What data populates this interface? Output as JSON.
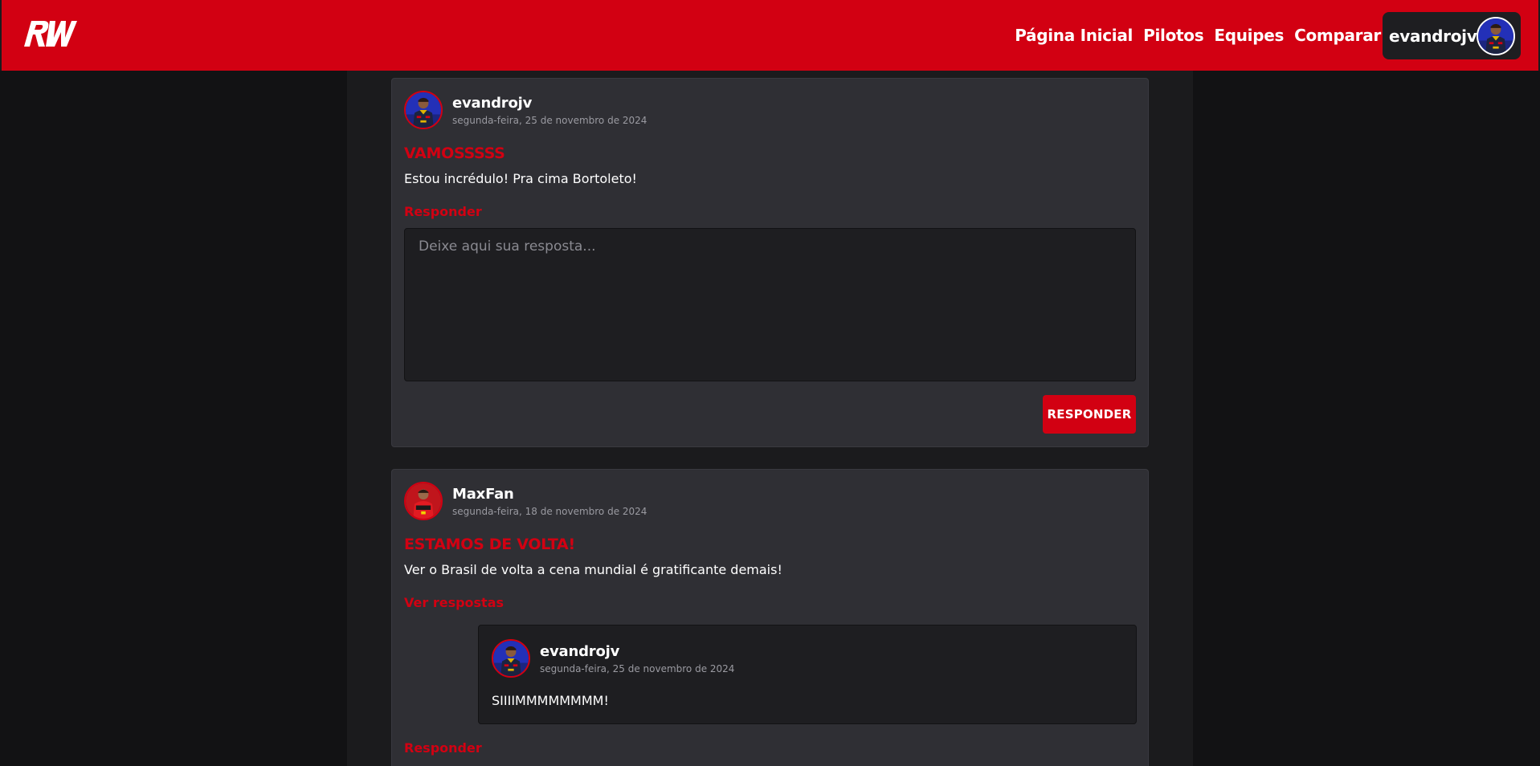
{
  "brand": {
    "logo_text": "RW",
    "accent_color": "#d20012"
  },
  "nav": {
    "links": [
      {
        "label": "Página Inicial"
      },
      {
        "label": "Pilotos"
      },
      {
        "label": "Equipes"
      },
      {
        "label": "Comparar"
      }
    ],
    "user": {
      "name": "evandrojv",
      "avatar_icon": "driver-avatar-redbull"
    }
  },
  "posts": [
    {
      "author": "evandrojv",
      "avatar_icon": "driver-avatar-redbull",
      "date": "segunda-feira, 25 de novembro de 2024",
      "title": "VAMOSSSSS",
      "body": "Estou incrédulo! Pra cima Bortoleto!",
      "reply_link": "Responder",
      "reply_placeholder": "Deixe aqui sua resposta...",
      "reply_value": "",
      "reply_button": "RESPONDER"
    },
    {
      "author": "MaxFan",
      "avatar_icon": "driver-avatar-ferrari",
      "date": "segunda-feira, 18 de novembro de 2024",
      "title": "ESTAMOS DE VOLTA!",
      "body": "Ver o Brasil de volta a cena mundial é gratificante demais!",
      "view_replies_link": "Ver respostas",
      "replies": [
        {
          "author": "evandrojv",
          "avatar_icon": "driver-avatar-redbull",
          "date": "segunda-feira, 25 de novembro de 2024",
          "text": "SIIIIMMMMMMMM!"
        }
      ],
      "reply_link": "Responder"
    }
  ]
}
